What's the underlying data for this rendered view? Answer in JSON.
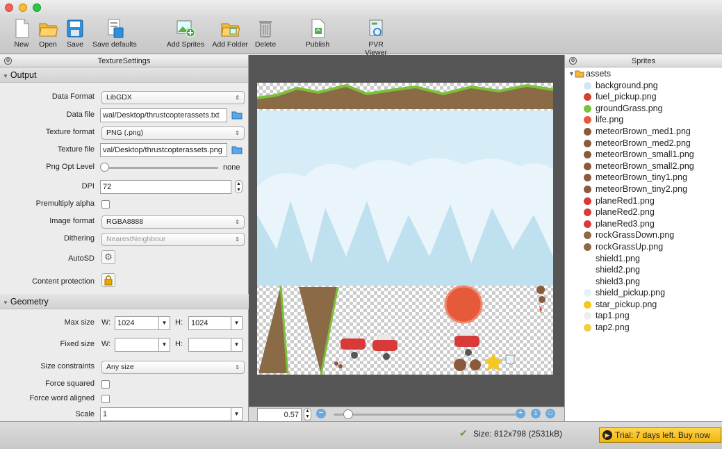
{
  "toolbar": {
    "new": "New",
    "open": "Open",
    "save": "Save",
    "save_defaults": "Save defaults",
    "add_sprites": "Add Sprites",
    "add_folder": "Add Folder",
    "delete": "Delete",
    "publish": "Publish",
    "pvr_viewer": "PVR Viewer"
  },
  "left": {
    "panel_title": "TextureSettings",
    "output_section": "Output",
    "geometry_section": "Geometry",
    "data_format": {
      "label": "Data Format",
      "value": "LibGDX"
    },
    "data_file": {
      "label": "Data file",
      "value": "wal/Desktop/thrustcopterassets.txt"
    },
    "texture_format": {
      "label": "Texture format",
      "value": "PNG (.png)"
    },
    "texture_file": {
      "label": "Texture file",
      "value": "val/Desktop/thrustcopterassets.png"
    },
    "png_opt": {
      "label": "Png Opt Level",
      "value": "none",
      "level": 0
    },
    "dpi": {
      "label": "DPI",
      "value": "72"
    },
    "premultiply": {
      "label": "Premultiply alpha"
    },
    "image_format": {
      "label": "Image format",
      "value": "RGBA8888"
    },
    "dithering": {
      "label": "Dithering",
      "value": "NearestNeighbour"
    },
    "autosd": {
      "label": "AutoSD"
    },
    "content_protection": {
      "label": "Content protection"
    },
    "max_size": {
      "label": "Max size",
      "w_label": "W:",
      "w": "1024",
      "h_label": "H:",
      "h": "1024"
    },
    "fixed_size": {
      "label": "Fixed size",
      "w_label": "W:",
      "w": "",
      "h_label": "H:",
      "h": ""
    },
    "size_constraints": {
      "label": "Size constraints",
      "value": "Any size"
    },
    "force_squared": {
      "label": "Force squared"
    },
    "force_word_aligned": {
      "label": "Force word aligned"
    },
    "scale": {
      "label": "Scale",
      "value": "1"
    }
  },
  "canvas": {
    "zoom": "0.57",
    "zoom_level": 0.08
  },
  "right": {
    "panel_title": "Sprites",
    "folder": "assets",
    "items": [
      "background.png",
      "fuel_pickup.png",
      "groundGrass.png",
      "life.png",
      "meteorBrown_med1.png",
      "meteorBrown_med2.png",
      "meteorBrown_small1.png",
      "meteorBrown_small2.png",
      "meteorBrown_tiny1.png",
      "meteorBrown_tiny2.png",
      "planeRed1.png",
      "planeRed2.png",
      "planeRed3.png",
      "rockGrassDown.png",
      "rockGrassUp.png",
      "shield1.png",
      "shield2.png",
      "shield3.png",
      "shield_pickup.png",
      "star_pickup.png",
      "tap1.png",
      "tap2.png"
    ]
  },
  "status": {
    "size": "Size: 812x798 (2531kB)",
    "trial": "Trial: 7 days left. Buy now"
  }
}
